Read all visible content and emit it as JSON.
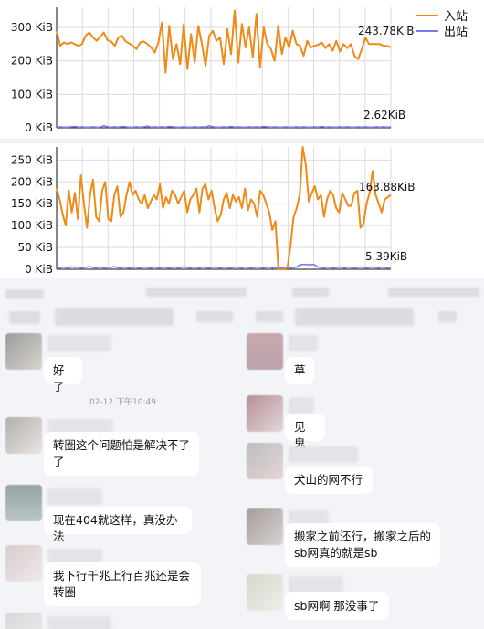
{
  "legend": {
    "in_label": "入站",
    "out_label": "出站",
    "in_color": "#ef8a17",
    "out_color": "#7b7bf0"
  },
  "chart_data": [
    {
      "type": "line",
      "ylabel": "",
      "y_ticks": [
        "0 KiB",
        "100 KiB",
        "200 KiB",
        "300 KiB"
      ],
      "ylim": [
        0,
        360
      ],
      "grid": true,
      "legend_position": "top-right",
      "series": [
        {
          "name": "入站",
          "color": "#ef8a17",
          "values": [
            290,
            245,
            255,
            250,
            255,
            250,
            245,
            250,
            275,
            285,
            270,
            260,
            272,
            285,
            262,
            258,
            245,
            270,
            275,
            258,
            252,
            245,
            235,
            255,
            258,
            250,
            240,
            225,
            255,
            315,
            165,
            305,
            205,
            250,
            190,
            310,
            175,
            280,
            195,
            305,
            250,
            185,
            275,
            290,
            260,
            270,
            190,
            295,
            220,
            350,
            195,
            310,
            240,
            300,
            210,
            340,
            180,
            300,
            250,
            235,
            200,
            305,
            220,
            270,
            240,
            290,
            250,
            245,
            215,
            260,
            240,
            245,
            248,
            255,
            238,
            250,
            230,
            260,
            228,
            250,
            238,
            250,
            215,
            205,
            235,
            270,
            250,
            250,
            250,
            250,
            245,
            245,
            240
          ],
          "end_label": "243.78KiB"
        },
        {
          "name": "出站",
          "color": "#7b7bf0",
          "values": [
            2,
            3,
            2,
            2,
            3,
            4,
            2,
            3,
            2,
            2,
            3,
            2,
            2,
            6,
            3,
            2,
            3,
            2,
            4,
            3,
            2,
            2,
            3,
            2,
            3,
            5,
            2,
            3,
            2,
            3,
            2,
            4,
            3,
            2,
            2,
            3,
            2,
            2,
            3,
            2,
            3,
            2,
            6,
            3,
            2,
            2,
            3,
            2,
            4,
            2,
            3,
            2,
            2,
            3,
            2,
            3,
            2,
            4,
            3,
            2,
            3,
            2,
            2,
            3,
            2,
            2,
            3,
            2,
            3,
            2,
            2,
            3,
            2,
            4,
            2,
            3,
            2,
            2,
            3,
            2,
            3,
            2,
            2,
            3,
            2,
            3,
            2,
            2,
            3,
            2,
            3,
            2,
            3
          ],
          "end_label": "2.62KiB"
        }
      ]
    },
    {
      "type": "line",
      "ylabel": "",
      "y_ticks": [
        "0 KiB",
        "50 KiB",
        "100 KiB",
        "150 KiB",
        "200 KiB",
        "250 KiB"
      ],
      "ylim": [
        0,
        280
      ],
      "grid": true,
      "series": [
        {
          "name": "入站",
          "color": "#ef8a17",
          "values": [
            185,
            160,
            125,
            100,
            180,
            130,
            175,
            115,
            215,
            150,
            95,
            170,
            205,
            120,
            110,
            180,
            200,
            115,
            110,
            170,
            190,
            120,
            130,
            170,
            200,
            170,
            180,
            160,
            150,
            170,
            140,
            155,
            170,
            160,
            195,
            140,
            165,
            150,
            180,
            170,
            150,
            165,
            180,
            130,
            160,
            170,
            185,
            130,
            185,
            195,
            160,
            180,
            140,
            110,
            125,
            160,
            175,
            140,
            170,
            155,
            165,
            140,
            185,
            135,
            160,
            150,
            120,
            180,
            170,
            150,
            130,
            90,
            110,
            0,
            0,
            0,
            5,
            55,
            120,
            140,
            170,
            280,
            240,
            155,
            175,
            190,
            160,
            170,
            120,
            160,
            180,
            170,
            140,
            130,
            175,
            160,
            145,
            145,
            175,
            180,
            95,
            105,
            150,
            175,
            225,
            170,
            150,
            130,
            160,
            165,
            170
          ],
          "end_label": "163.88KiB"
        },
        {
          "name": "出站",
          "color": "#7b7bf0",
          "values": [
            4,
            3,
            5,
            4,
            3,
            6,
            4,
            5,
            3,
            4,
            5,
            6,
            4,
            3,
            5,
            4,
            3,
            5,
            4,
            6,
            4,
            3,
            5,
            4,
            3,
            4,
            5,
            3,
            4,
            5,
            4,
            3,
            5,
            4,
            3,
            5,
            4,
            3,
            4,
            5,
            3,
            4,
            6,
            4,
            3,
            5,
            4,
            3,
            5,
            4,
            3,
            4,
            5,
            4,
            3,
            5,
            4,
            3,
            4,
            5,
            4,
            3,
            5,
            4,
            3,
            4,
            5,
            4,
            3,
            4,
            5,
            3,
            4,
            4,
            3,
            4,
            5,
            3,
            4,
            5,
            10,
            11,
            11,
            10,
            11,
            10,
            5,
            4,
            3,
            5,
            4,
            3,
            4,
            5,
            4,
            3,
            5,
            4,
            3,
            4,
            5,
            4,
            3,
            4,
            5,
            4,
            3,
            5,
            4,
            3,
            5
          ],
          "end_label": "5.39KiB"
        }
      ]
    }
  ],
  "chat": {
    "timestamp": "02-12 下午10:49",
    "left_messages": [
      "好了",
      "转圈这个问题怕是解决不了了",
      "现在404就这样，真没办法",
      "我下行千兆上行百兆还是会转圈"
    ],
    "right_messages": [
      "草",
      "见鬼",
      "犬山的网不行",
      "搬家之前还行，搬家之后的sb网真的就是sb",
      "sb网啊 那没事了"
    ]
  }
}
